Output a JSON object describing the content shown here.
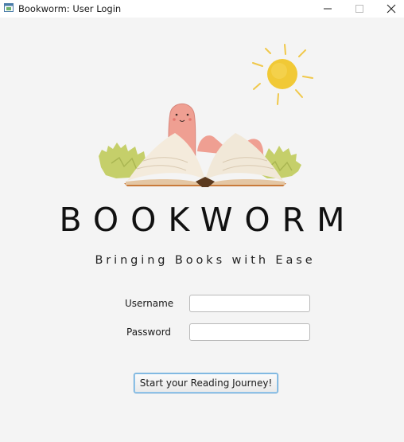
{
  "window": {
    "title": "Bookworm: User Login",
    "app_icon": "java-app-icon",
    "controls": [
      "minimize-icon",
      "maximize-icon",
      "close-icon"
    ]
  },
  "brand": {
    "logo_illustration": "worm-reading-open-book-with-sun",
    "name": "BOOKWORM",
    "tagline": "Bringing Books with Ease"
  },
  "form": {
    "username_label": "Username",
    "username_value": "",
    "password_label": "Password",
    "password_value": "",
    "submit_label": "Start your Reading Journey!"
  },
  "colors": {
    "background": "#f4f4f4",
    "button_focus_border": "#5aa0d3"
  }
}
